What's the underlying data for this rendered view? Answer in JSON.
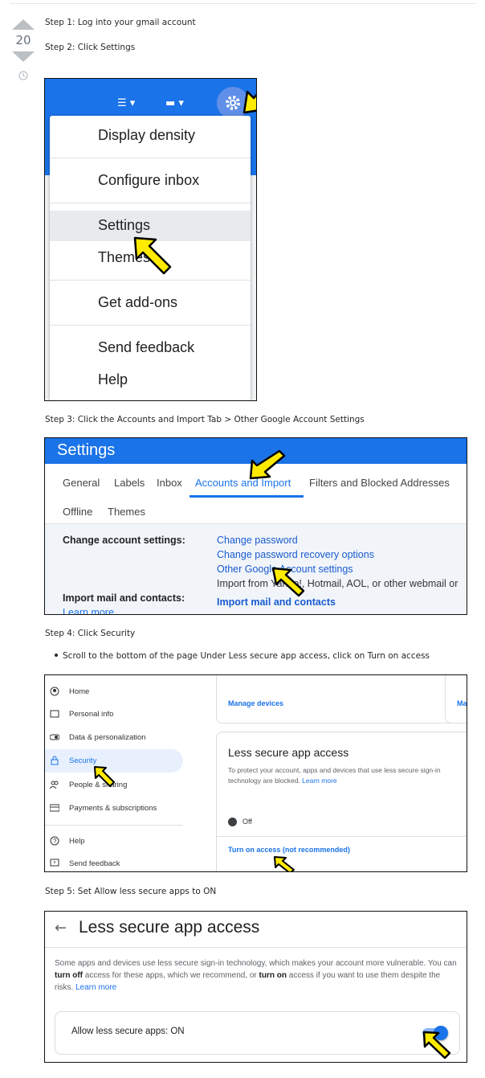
{
  "vote": {
    "score": "20"
  },
  "steps": {
    "step1": "Step 1: Log into your gmail account",
    "step2": "Step 2: Click Settings",
    "step3": "Step 3: Click the Accounts and Import Tab > Other Google Account Settings",
    "step4": "Step 4: Click Security",
    "step4_bullet": "Scroll to the bottom of the page Under Less secure app access, click on Turn on access",
    "step5": "Step 5: Set Allow less secure apps to ON"
  },
  "shot1": {
    "menu_items": [
      "Display density",
      "Configure inbox",
      "Settings",
      "Themes",
      "Get add-ons",
      "Send feedback",
      "Help"
    ]
  },
  "shot2": {
    "header": "Settings",
    "tabs": [
      "General",
      "Labels",
      "Inbox",
      "Accounts and Import",
      "Filters and Blocked Addresses",
      "Offline",
      "Themes"
    ],
    "change_label": "Change account settings:",
    "links": [
      "Change password",
      "Change password recovery options",
      "Other Google Account settings"
    ],
    "import_from": "Import from Yahoo!, Hotmail, AOL, or other webmail or",
    "import_label": "Import mail and contacts:",
    "learn_more": "Learn more",
    "import_link": "Import mail and contacts"
  },
  "shot3": {
    "nav": [
      "Home",
      "Personal info",
      "Data & personalization",
      "Security",
      "People & sharing",
      "Payments & subscriptions",
      "Help",
      "Send feedback"
    ],
    "manage_devices": "Manage devices",
    "ma": "Ma",
    "title": "Less secure app access",
    "desc": "To protect your account, apps and devices that use less secure sign-in technology are blocked.",
    "learn_more": "Learn more",
    "off": "Off",
    "turn_on": "Turn on access (not recommended)"
  },
  "shot4": {
    "title": "Less secure app access",
    "body_1": "Some apps and devices use less secure sign-in technology, which makes your account more vulnerable. You can ",
    "turn_off": "turn off",
    "body_2": " access for these apps, which we recommend, or ",
    "turn_on": "turn on",
    "body_3": " access if you want to use them despite the risks. ",
    "learn_more": "Learn more",
    "allow": "Allow less secure apps: ON",
    "toggle_on": true
  },
  "colors": {
    "accent": "#1a73e8",
    "pointer": "#ffeb00"
  }
}
